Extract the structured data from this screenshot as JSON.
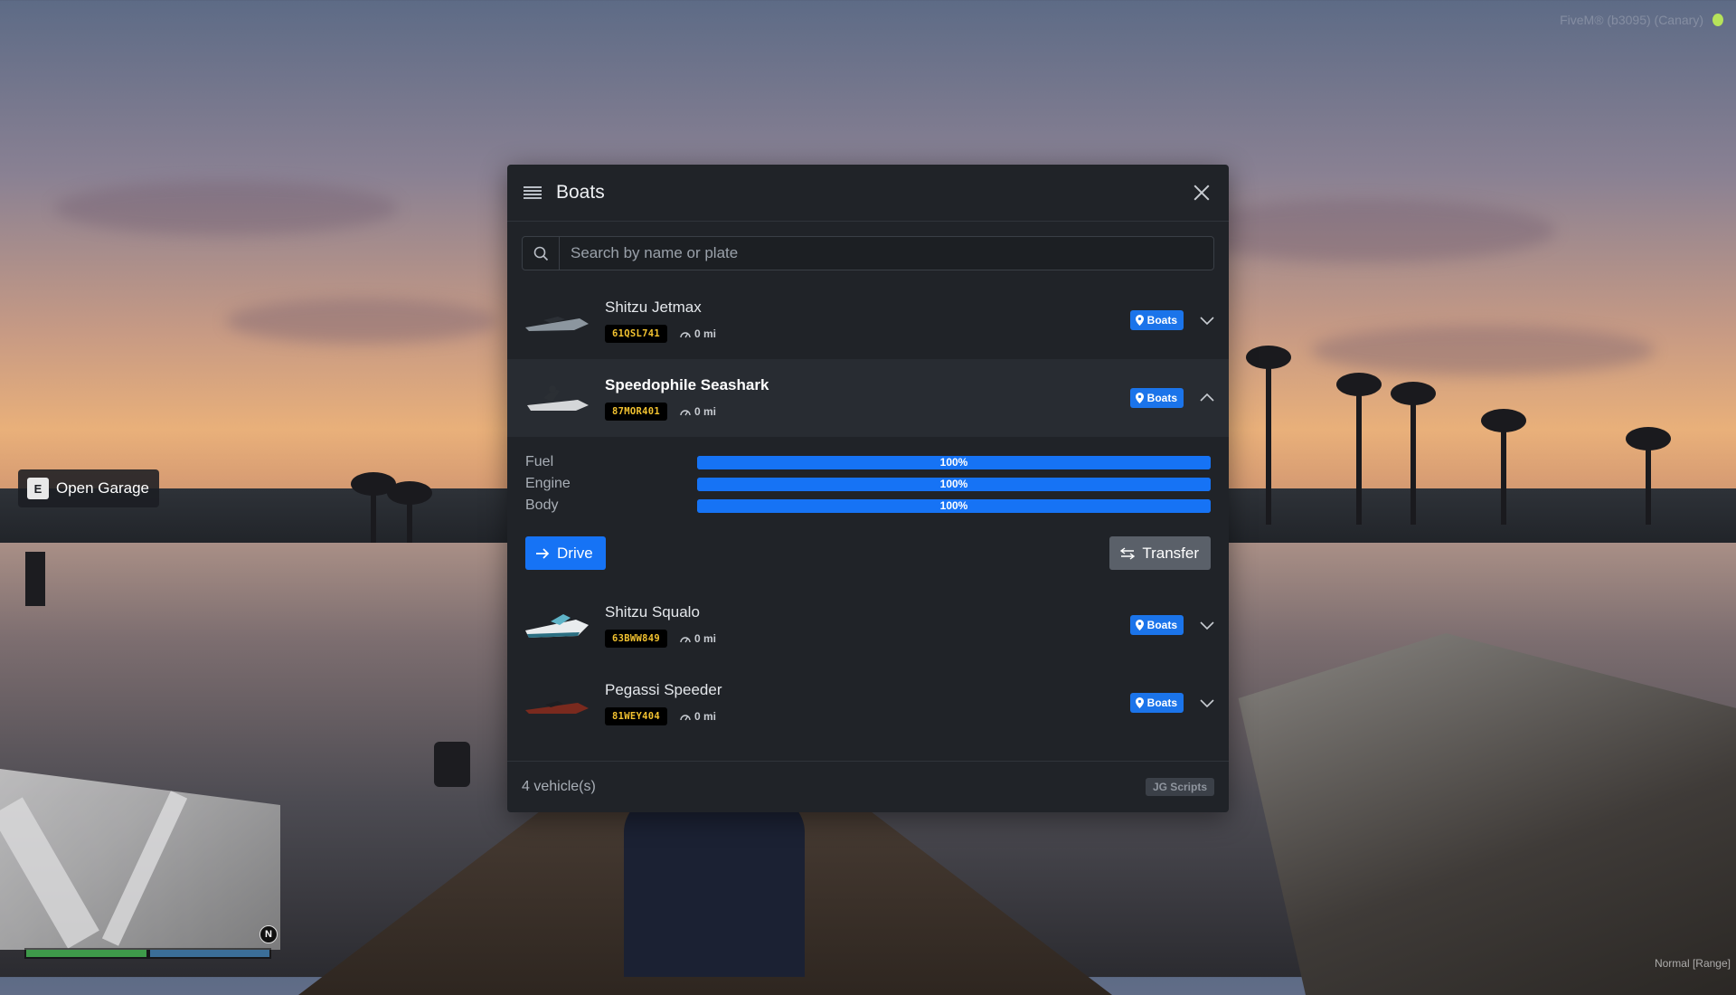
{
  "hud": {
    "server_tag": "FiveM® (b3095) (Canary)",
    "prompt_key": "E",
    "prompt_label": "Open Garage",
    "compass": "N",
    "mode": "Normal [Range]"
  },
  "garage": {
    "title": "Boats",
    "search_placeholder": "Search by name or plate",
    "vehicles": [
      {
        "name": "Shitzu Jetmax",
        "plate": "61QSL741",
        "mileage": "0 mi",
        "location": "Boats",
        "expanded": false
      },
      {
        "name": "Speedophile Seashark",
        "plate": "87MOR401",
        "mileage": "0 mi",
        "location": "Boats",
        "expanded": true
      },
      {
        "name": "Shitzu Squalo",
        "plate": "63BWW849",
        "mileage": "0 mi",
        "location": "Boats",
        "expanded": false
      },
      {
        "name": "Pegassi Speeder",
        "plate": "81WEY404",
        "mileage": "0 mi",
        "location": "Boats",
        "expanded": false
      }
    ],
    "details": {
      "stats": [
        {
          "label": "Fuel",
          "value": "100%",
          "level": 1.0
        },
        {
          "label": "Engine",
          "value": "100%",
          "level": 1.0
        },
        {
          "label": "Body",
          "value": "100%",
          "level": 1.0
        }
      ],
      "drive_label": "Drive",
      "transfer_label": "Transfer"
    },
    "footer_count": "4 vehicle(s)",
    "footer_brand": "JG Scripts"
  },
  "colors": {
    "accent": "#1673f5",
    "plate_text": "#f2c230",
    "panel_bg": "#202328"
  }
}
